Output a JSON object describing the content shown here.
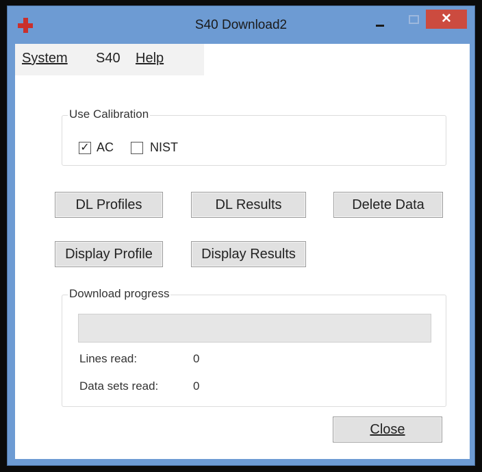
{
  "window": {
    "title": "S40 Download2",
    "close_glyph": "✕",
    "app_icon": "red-cross-icon"
  },
  "menu": {
    "items": [
      {
        "label": "System"
      },
      {
        "label": "S40"
      },
      {
        "label": "Help"
      }
    ]
  },
  "calibration": {
    "group_label": "Use Calibration",
    "ac": {
      "label": "AC",
      "checked": true,
      "glyph": "✓"
    },
    "nist": {
      "label": "NIST",
      "checked": false
    }
  },
  "buttons": {
    "dl_profiles": "DL Profiles",
    "dl_results": "DL Results",
    "delete_data": "Delete Data",
    "display_profile": "Display Profile",
    "display_results": "Display Results",
    "close": "Close"
  },
  "download": {
    "group_label": "Download progress",
    "progress": 0,
    "lines_read_label": "Lines read:",
    "lines_read_value": "0",
    "data_sets_label": "Data sets read:",
    "data_sets_value": "0"
  }
}
